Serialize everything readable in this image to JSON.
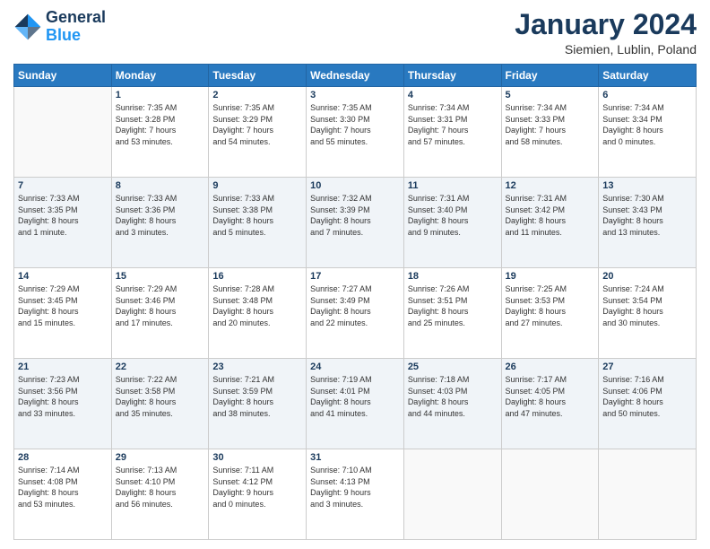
{
  "header": {
    "logo_line1": "General",
    "logo_line2": "Blue",
    "month": "January 2024",
    "location": "Siemien, Lublin, Poland"
  },
  "weekdays": [
    "Sunday",
    "Monday",
    "Tuesday",
    "Wednesday",
    "Thursday",
    "Friday",
    "Saturday"
  ],
  "weeks": [
    [
      {
        "day": "",
        "info": ""
      },
      {
        "day": "1",
        "info": "Sunrise: 7:35 AM\nSunset: 3:28 PM\nDaylight: 7 hours\nand 53 minutes."
      },
      {
        "day": "2",
        "info": "Sunrise: 7:35 AM\nSunset: 3:29 PM\nDaylight: 7 hours\nand 54 minutes."
      },
      {
        "day": "3",
        "info": "Sunrise: 7:35 AM\nSunset: 3:30 PM\nDaylight: 7 hours\nand 55 minutes."
      },
      {
        "day": "4",
        "info": "Sunrise: 7:34 AM\nSunset: 3:31 PM\nDaylight: 7 hours\nand 57 minutes."
      },
      {
        "day": "5",
        "info": "Sunrise: 7:34 AM\nSunset: 3:33 PM\nDaylight: 7 hours\nand 58 minutes."
      },
      {
        "day": "6",
        "info": "Sunrise: 7:34 AM\nSunset: 3:34 PM\nDaylight: 8 hours\nand 0 minutes."
      }
    ],
    [
      {
        "day": "7",
        "info": "Sunrise: 7:33 AM\nSunset: 3:35 PM\nDaylight: 8 hours\nand 1 minute."
      },
      {
        "day": "8",
        "info": "Sunrise: 7:33 AM\nSunset: 3:36 PM\nDaylight: 8 hours\nand 3 minutes."
      },
      {
        "day": "9",
        "info": "Sunrise: 7:33 AM\nSunset: 3:38 PM\nDaylight: 8 hours\nand 5 minutes."
      },
      {
        "day": "10",
        "info": "Sunrise: 7:32 AM\nSunset: 3:39 PM\nDaylight: 8 hours\nand 7 minutes."
      },
      {
        "day": "11",
        "info": "Sunrise: 7:31 AM\nSunset: 3:40 PM\nDaylight: 8 hours\nand 9 minutes."
      },
      {
        "day": "12",
        "info": "Sunrise: 7:31 AM\nSunset: 3:42 PM\nDaylight: 8 hours\nand 11 minutes."
      },
      {
        "day": "13",
        "info": "Sunrise: 7:30 AM\nSunset: 3:43 PM\nDaylight: 8 hours\nand 13 minutes."
      }
    ],
    [
      {
        "day": "14",
        "info": "Sunrise: 7:29 AM\nSunset: 3:45 PM\nDaylight: 8 hours\nand 15 minutes."
      },
      {
        "day": "15",
        "info": "Sunrise: 7:29 AM\nSunset: 3:46 PM\nDaylight: 8 hours\nand 17 minutes."
      },
      {
        "day": "16",
        "info": "Sunrise: 7:28 AM\nSunset: 3:48 PM\nDaylight: 8 hours\nand 20 minutes."
      },
      {
        "day": "17",
        "info": "Sunrise: 7:27 AM\nSunset: 3:49 PM\nDaylight: 8 hours\nand 22 minutes."
      },
      {
        "day": "18",
        "info": "Sunrise: 7:26 AM\nSunset: 3:51 PM\nDaylight: 8 hours\nand 25 minutes."
      },
      {
        "day": "19",
        "info": "Sunrise: 7:25 AM\nSunset: 3:53 PM\nDaylight: 8 hours\nand 27 minutes."
      },
      {
        "day": "20",
        "info": "Sunrise: 7:24 AM\nSunset: 3:54 PM\nDaylight: 8 hours\nand 30 minutes."
      }
    ],
    [
      {
        "day": "21",
        "info": "Sunrise: 7:23 AM\nSunset: 3:56 PM\nDaylight: 8 hours\nand 33 minutes."
      },
      {
        "day": "22",
        "info": "Sunrise: 7:22 AM\nSunset: 3:58 PM\nDaylight: 8 hours\nand 35 minutes."
      },
      {
        "day": "23",
        "info": "Sunrise: 7:21 AM\nSunset: 3:59 PM\nDaylight: 8 hours\nand 38 minutes."
      },
      {
        "day": "24",
        "info": "Sunrise: 7:19 AM\nSunset: 4:01 PM\nDaylight: 8 hours\nand 41 minutes."
      },
      {
        "day": "25",
        "info": "Sunrise: 7:18 AM\nSunset: 4:03 PM\nDaylight: 8 hours\nand 44 minutes."
      },
      {
        "day": "26",
        "info": "Sunrise: 7:17 AM\nSunset: 4:05 PM\nDaylight: 8 hours\nand 47 minutes."
      },
      {
        "day": "27",
        "info": "Sunrise: 7:16 AM\nSunset: 4:06 PM\nDaylight: 8 hours\nand 50 minutes."
      }
    ],
    [
      {
        "day": "28",
        "info": "Sunrise: 7:14 AM\nSunset: 4:08 PM\nDaylight: 8 hours\nand 53 minutes."
      },
      {
        "day": "29",
        "info": "Sunrise: 7:13 AM\nSunset: 4:10 PM\nDaylight: 8 hours\nand 56 minutes."
      },
      {
        "day": "30",
        "info": "Sunrise: 7:11 AM\nSunset: 4:12 PM\nDaylight: 9 hours\nand 0 minutes."
      },
      {
        "day": "31",
        "info": "Sunrise: 7:10 AM\nSunset: 4:13 PM\nDaylight: 9 hours\nand 3 minutes."
      },
      {
        "day": "",
        "info": ""
      },
      {
        "day": "",
        "info": ""
      },
      {
        "day": "",
        "info": ""
      }
    ]
  ]
}
